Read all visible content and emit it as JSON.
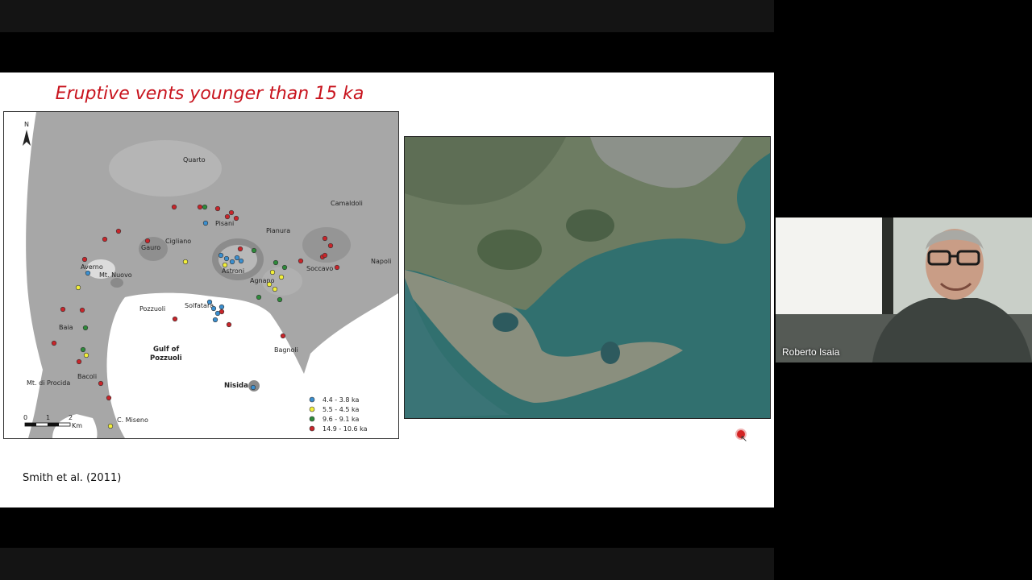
{
  "slide": {
    "title": "Eruptive vents younger than 15 ka",
    "citation": "Smith et al. (2011)"
  },
  "map": {
    "north_label": "N",
    "place_labels": [
      "Quarto",
      "Camaldoli",
      "Pianura",
      "Pisani",
      "Cigliano",
      "Gauro",
      "Averno",
      "Mt. Nuovo",
      "Astroni",
      "Agnano",
      "Soccavo",
      "Napoli",
      "Pozzuoli",
      "Solfatara",
      "Baia",
      "Gulf of",
      "Pozzuoli",
      "Bagnoli",
      "Bacoli",
      "Mt. di Procida",
      "Nisida",
      "C. Miseno"
    ],
    "legend": [
      {
        "label": "4.4 - 3.8 ka",
        "color": "#3b8fcf"
      },
      {
        "label": "5.5 - 4.5 ka",
        "color": "#f2ef3a"
      },
      {
        "label": "9.6 - 9.1 ka",
        "color": "#2e8a3a"
      },
      {
        "label": "14.9 - 10.6 ka",
        "color": "#c8252a"
      }
    ],
    "scale": {
      "ticks": [
        "0",
        "1",
        "2"
      ],
      "unit": "Km"
    }
  },
  "video": {
    "participant_name": "Roberto Isaia"
  }
}
